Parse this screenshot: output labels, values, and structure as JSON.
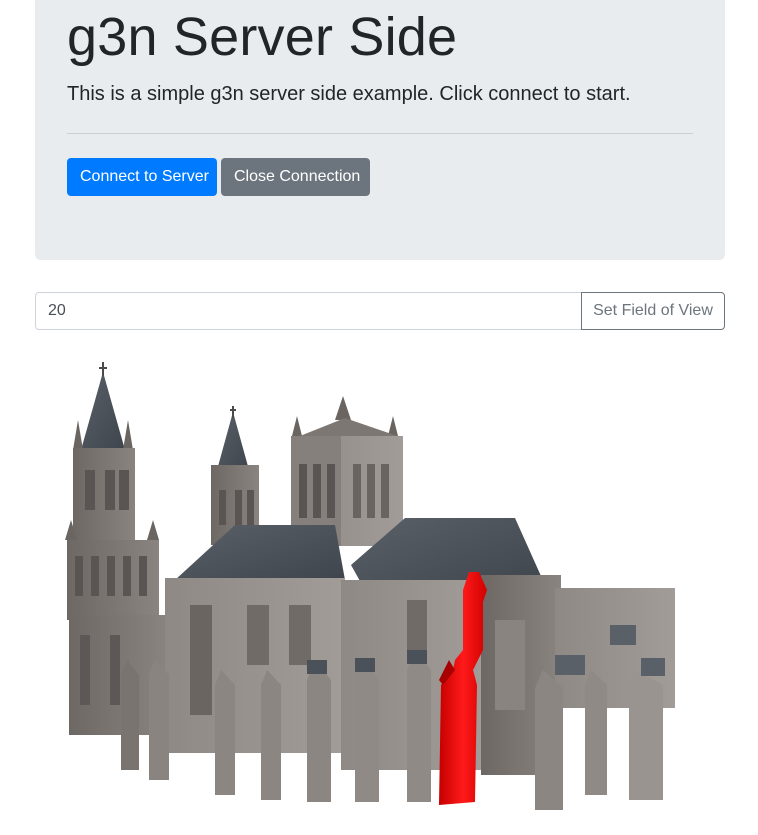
{
  "header": {
    "title": "g3n Server Side",
    "lead": "This is a simple g3n server side example. Click connect to start."
  },
  "actions": {
    "connect_label": "Connect to Server",
    "close_label": "Close Connection"
  },
  "field_of_view": {
    "value": "20",
    "button_label": "Set Field of View"
  },
  "scene": {
    "model": "cathedral",
    "highlight_color": "#ff0000",
    "stone_color": "#7a7470",
    "roof_color": "#4b5158"
  },
  "colors": {
    "primary": "#007bff",
    "secondary": "#6c757d",
    "jumbotron_bg": "#e9ecef"
  }
}
